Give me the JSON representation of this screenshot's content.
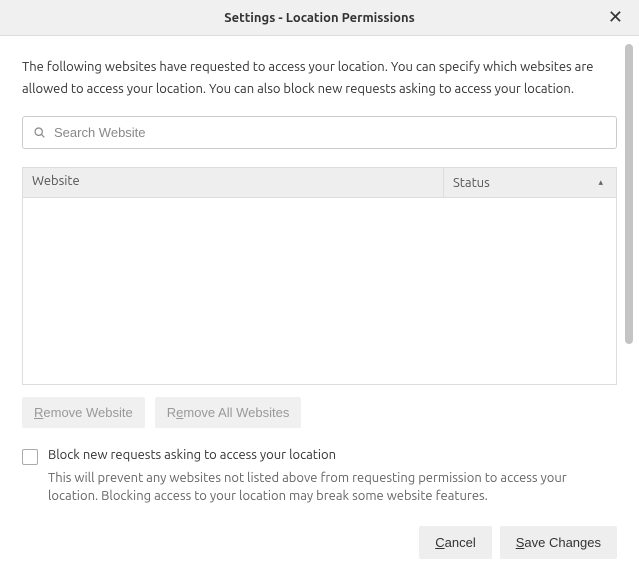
{
  "header": {
    "title": "Settings - Location Permissions"
  },
  "description": "The following websites have requested to access your location. You can specify which websites are allowed to access your location. You can also block new requests asking to access your location.",
  "search": {
    "placeholder": "Search Website"
  },
  "table": {
    "columns": {
      "website": "Website",
      "status": "Status"
    },
    "rows": []
  },
  "buttons": {
    "remove_website": {
      "mnemonic": "R",
      "rest": "emove Website"
    },
    "remove_all": {
      "mnemonic_pre": "R",
      "mnemonic": "e",
      "rest": "move All Websites"
    }
  },
  "checkbox": {
    "label": "Block new requests asking to access your location",
    "description": "This will prevent any websites not listed above from requesting permission to access your location. Blocking access to your location may break some website features."
  },
  "footer": {
    "cancel": {
      "mnemonic": "C",
      "rest": "ancel"
    },
    "save": {
      "mnemonic": "S",
      "rest": "ave Changes"
    }
  }
}
